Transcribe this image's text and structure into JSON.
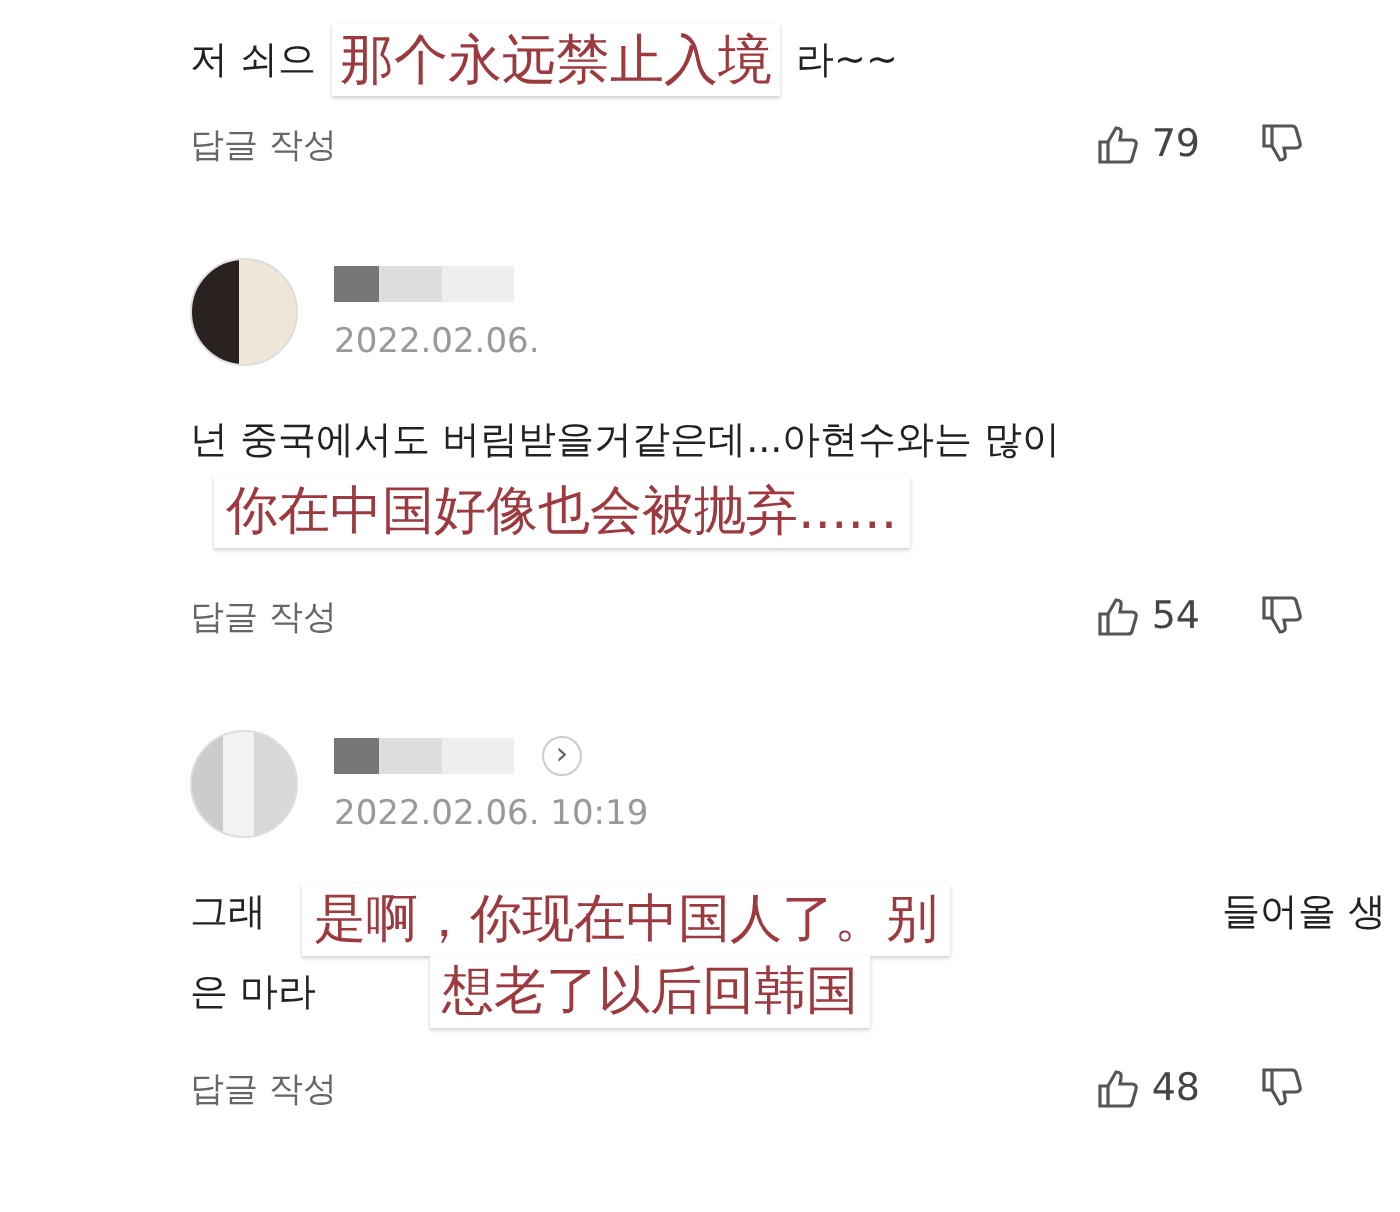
{
  "comments": [
    {
      "kind": "partial",
      "segments": [
        {
          "kind": "text",
          "text": "저 쇠으"
        },
        {
          "kind": "caption",
          "text": "那个永远禁止入境"
        },
        {
          "kind": "text",
          "text": "라~~"
        }
      ],
      "reply": "답글 작성",
      "likes": "79"
    },
    {
      "kind": "full",
      "date": "2022.02.06.",
      "lines": [
        [
          "넌 중국에서도 버림받을거같은데...아현수와는 많이"
        ]
      ],
      "caption": [
        "你在中国好像也会被抛弃......"
      ],
      "reply": "답글 작성",
      "likes": "54"
    },
    {
      "kind": "full",
      "date": "2022.02.06. 10:19",
      "chevron": "›",
      "lines": [
        [
          "그래",
          "들어올 생"
        ],
        [
          "은 마라"
        ]
      ],
      "caption": [
        "是啊，你现在中国人了。别",
        "想老了以后回韩国"
      ],
      "reply": "답글 작성",
      "likes": "48"
    }
  ]
}
